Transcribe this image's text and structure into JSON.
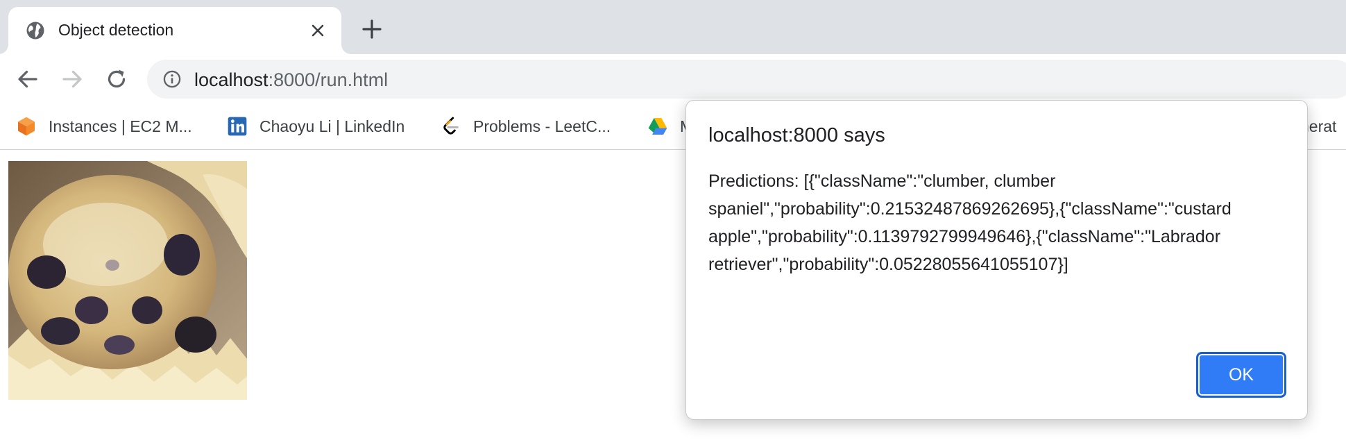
{
  "browser": {
    "tab": {
      "title": "Object detection",
      "favicon": "globe-icon"
    },
    "toolbar": {
      "back_icon": "arrow-left-icon",
      "forward_icon": "arrow-right-icon",
      "reload_icon": "reload-icon",
      "url_host": "localhost",
      "url_rest": ":8000/run.html",
      "site_info_icon": "info-icon"
    },
    "bookmarks": [
      {
        "label": "Instances | EC2 M...",
        "icon": "aws-cube-icon"
      },
      {
        "label": "Chaoyu Li | LinkedIn",
        "icon": "linkedin-icon"
      },
      {
        "label": "Problems - LeetC...",
        "icon": "leetcode-icon"
      },
      {
        "label": "M",
        "icon": "google-drive-icon"
      },
      {
        "label": "nerat",
        "icon": ""
      }
    ]
  },
  "page": {
    "image_alt": "blueberry muffin"
  },
  "dialog": {
    "title": "localhost:8000 says",
    "message": "Predictions: [{\"className\":\"clumber, clumber spaniel\",\"probability\":0.21532487869262695},{\"className\":\"custard apple\",\"probability\":0.1139792799949646},{\"className\":\"Labrador retriever\",\"probability\":0.05228055641055107}]",
    "ok_label": "OK"
  },
  "colors": {
    "tabstrip": "#dee1e6",
    "omnibox": "#f1f3f4",
    "accent_button": "#2f7cf6"
  }
}
